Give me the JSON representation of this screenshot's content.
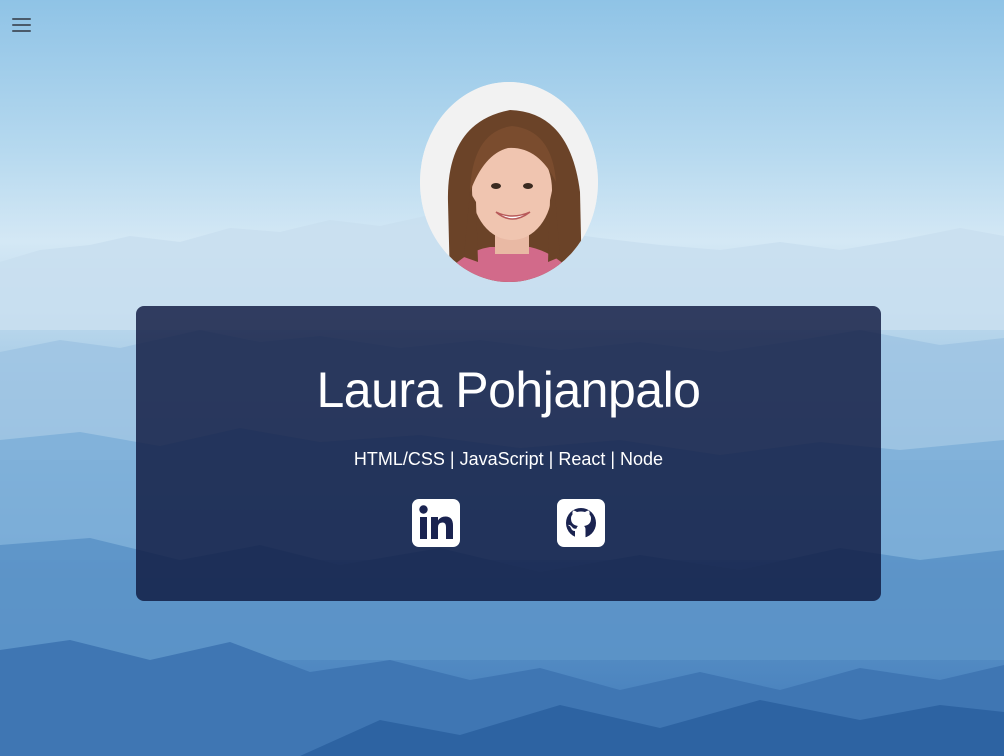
{
  "header": {
    "menu_icon": "hamburger-menu-icon"
  },
  "profile": {
    "name": "Laura Pohjanpalo",
    "skills": "HTML/CSS | JavaScript | React | Node",
    "photo": "profile-photo"
  },
  "social": [
    {
      "icon": "linkedin-icon"
    },
    {
      "icon": "github-icon"
    }
  ],
  "colors": {
    "card_background": "#0f1840",
    "text": "#ffffff",
    "sky": "#8fc3e6",
    "mountains": "#3f78b6"
  }
}
